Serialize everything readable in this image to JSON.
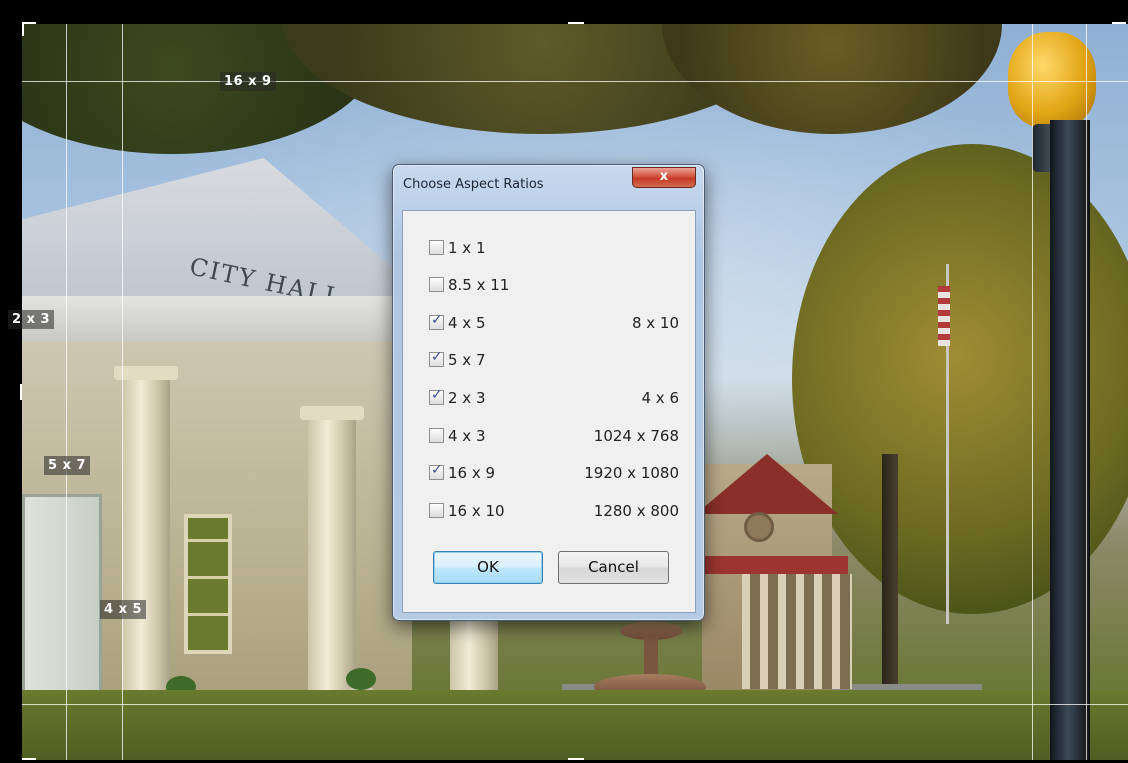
{
  "overlay_labels": {
    "guide_16x9": "16 x 9",
    "guide_2x3": "2 x 3",
    "guide_5x7": "5 x 7",
    "guide_4x5": "4 x 5"
  },
  "photo": {
    "building_sign": "CITY HALL"
  },
  "dialog": {
    "title": "Choose Aspect Ratios",
    "close_label": "x",
    "options": [
      {
        "label": "1 x 1",
        "checked": false,
        "equivalent": ""
      },
      {
        "label": "8.5 x 11",
        "checked": false,
        "equivalent": ""
      },
      {
        "label": "4 x 5",
        "checked": true,
        "equivalent": "8 x 10"
      },
      {
        "label": "5 x 7",
        "checked": true,
        "equivalent": ""
      },
      {
        "label": "2 x 3",
        "checked": true,
        "equivalent": "4 x 6"
      },
      {
        "label": "4 x 3",
        "checked": false,
        "equivalent": "1024 x 768"
      },
      {
        "label": "16 x 9",
        "checked": true,
        "equivalent": "1920 x 1080"
      },
      {
        "label": "16 x 10",
        "checked": false,
        "equivalent": "1280 x 800"
      }
    ],
    "ok_label": "OK",
    "cancel_label": "Cancel"
  },
  "colors": {
    "close_button": "#c23a24",
    "checkmark": "#3c4f8a",
    "default_button_border": "#3c7fb1"
  }
}
